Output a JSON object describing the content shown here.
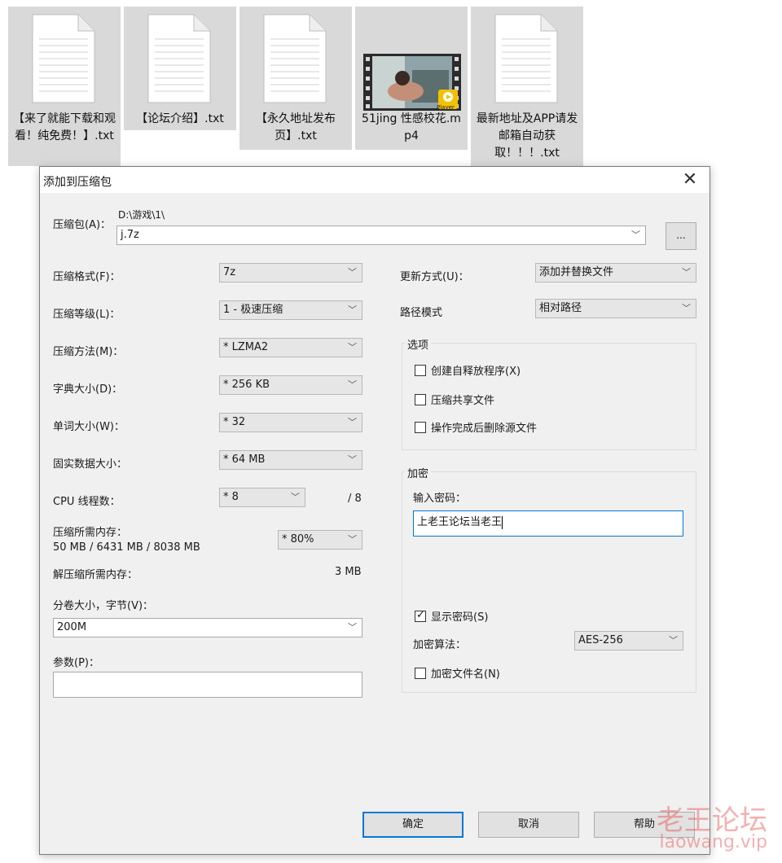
{
  "desktop": {
    "files": [
      {
        "name": "【来了就能下载和观看！纯免费！】.txt",
        "type": "text"
      },
      {
        "name": "【论坛介绍】.txt",
        "type": "text"
      },
      {
        "name": "【永久地址发布页】.txt",
        "type": "text"
      },
      {
        "name": "51jing 性感校花.mp4",
        "type": "video",
        "badge": "Player"
      },
      {
        "name": "最新地址及APP请发邮箱自动获取！！！.txt",
        "type": "text"
      }
    ]
  },
  "dialog": {
    "title": "添加到压缩包",
    "close_icon": "close-icon",
    "archive": {
      "label": "压缩包(A)：",
      "path": "D:\\游戏\\1\\",
      "filename": "j.7z",
      "browse_label": "..."
    },
    "left": {
      "format": {
        "label": "压缩格式(F)：",
        "value": "7z"
      },
      "level": {
        "label": "压缩等级(L)：",
        "value": "1 - 极速压缩"
      },
      "method": {
        "label": "压缩方法(M)：",
        "value": "* LZMA2"
      },
      "dict": {
        "label": "字典大小(D)：",
        "value": "* 256 KB"
      },
      "word": {
        "label": "单词大小(W)：",
        "value": "* 32"
      },
      "solid": {
        "label": "固实数据大小：",
        "value": "* 64 MB"
      },
      "cpu": {
        "label": "CPU 线程数：",
        "value": "* 8",
        "max": "/ 8"
      },
      "memory": {
        "label": "压缩所需内存：",
        "detail": "50 MB / 6431 MB / 8038 MB",
        "value": "* 80%"
      },
      "decomp": {
        "label": "解压缩所需内存：",
        "value": "3 MB"
      },
      "volume": {
        "label": "分卷大小，字节(V)：",
        "value": "200M"
      },
      "params": {
        "label": "参数(P)：",
        "value": ""
      }
    },
    "right": {
      "update": {
        "label": "更新方式(U)：",
        "value": "添加并替换文件"
      },
      "pathmode": {
        "label": "路径模式",
        "value": "相对路径"
      },
      "options": {
        "title": "选项",
        "sfx": {
          "label": "创建自释放程序(X)",
          "checked": false
        },
        "shared": {
          "label": "压缩共享文件",
          "checked": false
        },
        "delete": {
          "label": "操作完成后删除源文件",
          "checked": false
        }
      },
      "encryption": {
        "title": "加密",
        "password_label": "输入密码：",
        "password": "上老王论坛当老王",
        "show": {
          "label": "显示密码(S)",
          "checked": true
        },
        "algo": {
          "label": "加密算法：",
          "value": "AES-256"
        },
        "encnames": {
          "label": "加密文件名(N)",
          "checked": false
        }
      }
    },
    "buttons": {
      "ok": "确定",
      "cancel": "取消",
      "help": "帮助"
    }
  },
  "watermark": {
    "line1": "老王论坛",
    "line2": "laowang.vip",
    "color": "#e65050"
  }
}
